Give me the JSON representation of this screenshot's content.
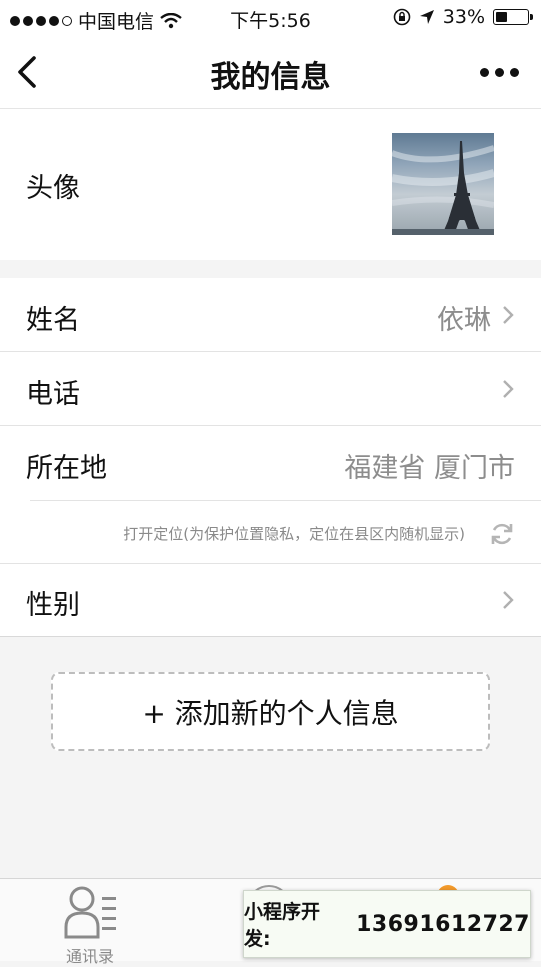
{
  "status_bar": {
    "carrier": "中国电信",
    "time": "下午5:56",
    "battery": "33%",
    "signal_bars": 4,
    "battery_level": 0.33
  },
  "nav": {
    "title": "我的信息"
  },
  "profile": {
    "avatar_label": "头像"
  },
  "fields": [
    {
      "label": "姓名",
      "value": "依琳"
    },
    {
      "label": "电话",
      "value": ""
    },
    {
      "label": "所在地",
      "value": "福建省 厦门市"
    },
    {
      "label": "性别",
      "value": ""
    }
  ],
  "location_hint": "打开定位(为保护位置隐私，定位在县区内随机显示)",
  "add_button": "+ 添加新的个人信息",
  "tabbar": {
    "contacts_label": "通讯录"
  },
  "promo": {
    "prefix": "小程序开发:",
    "phone": "13691612727"
  },
  "colors": {
    "badge": "#f39a2b",
    "secondary_text": "#8d8d8d"
  }
}
